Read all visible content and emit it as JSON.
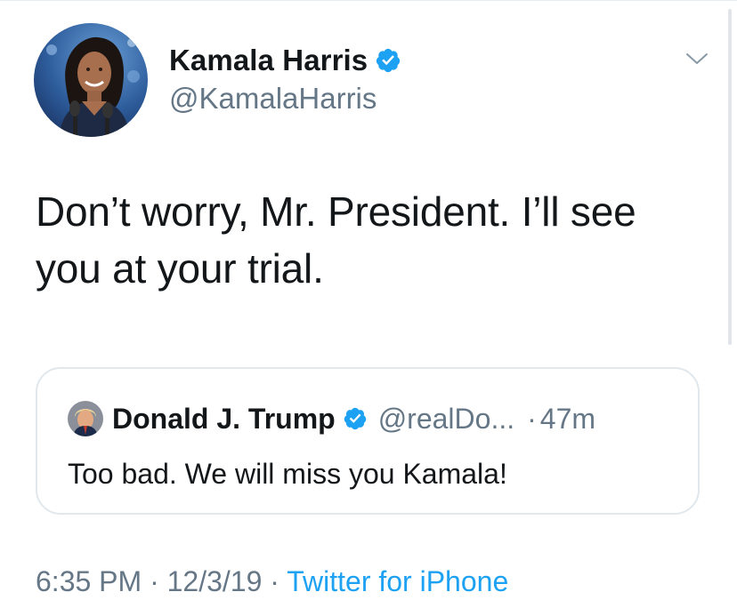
{
  "tweet": {
    "author": {
      "display_name": "Kamala Harris",
      "handle": "@KamalaHarris",
      "verified_icon": "verified-badge-icon",
      "avatar": "profile-photo"
    },
    "text_line1": "Don’t worry, Mr. President. I’ll see",
    "text_line2": "you at your trial.",
    "menu_icon": "chevron-down-icon",
    "quoted": {
      "display_name": "Donald J. Trump",
      "handle": "@realDo...",
      "separator": "·",
      "time": "47m",
      "text": "Too bad. We will miss you Kamala!",
      "verified_icon": "verified-badge-icon"
    },
    "meta": {
      "time": "6:35 PM",
      "sep1": "·",
      "date": "12/3/19",
      "sep2": "·",
      "source": "Twitter for iPhone"
    }
  },
  "colors": {
    "text": "#14171a",
    "secondary": "#657786",
    "link": "#1da1f2",
    "verified": "#1da1f2",
    "border": "#e1e8ed"
  }
}
